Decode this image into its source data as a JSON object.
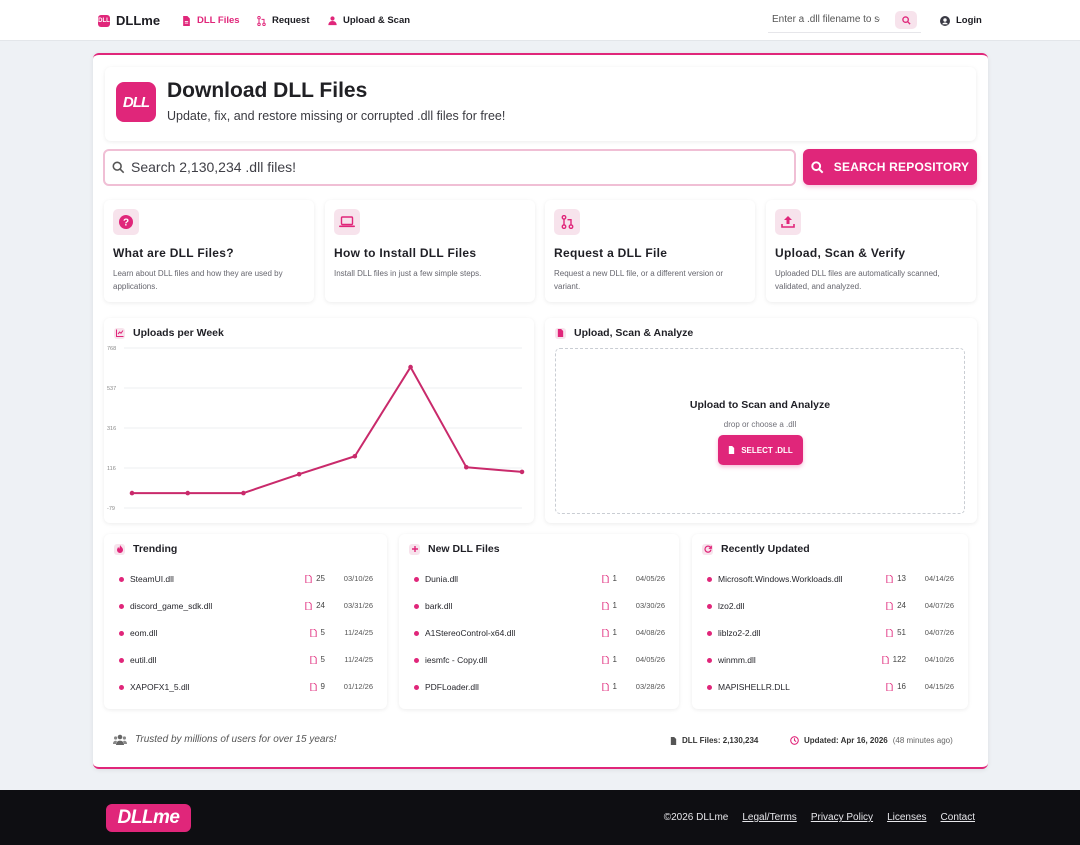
{
  "nav": {
    "brand": "DLLme",
    "brand_mark": "DLL",
    "links": [
      {
        "label": "DLL Files",
        "icon": "file-icon",
        "active": true
      },
      {
        "label": "Request",
        "icon": "request-icon"
      },
      {
        "label": "Upload & Scan",
        "icon": "upload-user-icon"
      }
    ],
    "search_placeholder": "Enter a .dll filename to search",
    "login_label": "Login"
  },
  "hero": {
    "logo_text": "DLL",
    "title": "Download DLL Files",
    "subtitle": "Update, fix, and restore missing or corrupted .dll files for free!"
  },
  "repo_search": {
    "placeholder": "Search 2,130,234 .dll files!",
    "button_label": "SEARCH REPOSITORY"
  },
  "features": [
    {
      "icon": "question-icon",
      "title": "What are DLL Files?",
      "desc": "Learn about DLL files and how they are used by applications."
    },
    {
      "icon": "laptop-icon",
      "title": "How to Install DLL Files",
      "desc": "Install DLL files in just a few simple steps."
    },
    {
      "icon": "pull-request-icon",
      "title": "Request a DLL File",
      "desc": "Request a new DLL file, or a different version or variant."
    },
    {
      "icon": "upload-icon",
      "title": "Upload, Scan & Verify",
      "desc": "Uploaded DLL files are automatically scanned, validated, and analyzed."
    }
  ],
  "chart_panel": {
    "title": "Uploads per Week"
  },
  "chart_data": {
    "type": "line",
    "x": [
      1,
      2,
      3,
      4,
      5,
      6,
      7,
      8
    ],
    "series": [
      {
        "values": [
          0,
          0,
          0,
          100,
          195,
          667,
          137,
          112
        ]
      }
    ],
    "ytick_labels": [
      "768",
      "537",
      "316",
      "116",
      "-79"
    ],
    "ylim": [
      -79,
      768
    ],
    "grid": true,
    "legend": "none",
    "color": "#c92a6b"
  },
  "upload_panel": {
    "title": "Upload, Scan & Analyze",
    "drop_title": "Upload to Scan and Analyze",
    "drop_sub": "drop or choose a .dll",
    "button_label": "SELECT .DLL"
  },
  "trending": {
    "title": "Trending",
    "items": [
      {
        "name": "SteamUI.dll",
        "count": "25",
        "date": "03/10/26"
      },
      {
        "name": "discord_game_sdk.dll",
        "count": "24",
        "date": "03/31/26"
      },
      {
        "name": "eom.dll",
        "count": "5",
        "date": "11/24/25"
      },
      {
        "name": "eutil.dll",
        "count": "5",
        "date": "11/24/25"
      },
      {
        "name": "XAPOFX1_5.dll",
        "count": "9",
        "date": "01/12/26"
      }
    ]
  },
  "new_files": {
    "title": "New DLL Files",
    "items": [
      {
        "name": "Dunia.dll",
        "count": "1",
        "date": "04/05/26"
      },
      {
        "name": "bark.dll",
        "count": "1",
        "date": "03/30/26"
      },
      {
        "name": "A1StereoControl-x64.dll",
        "count": "1",
        "date": "04/08/26"
      },
      {
        "name": "iesmfc - Copy.dll",
        "count": "1",
        "date": "04/05/26"
      },
      {
        "name": "PDFLoader.dll",
        "count": "1",
        "date": "03/28/26"
      }
    ]
  },
  "recent": {
    "title": "Recently Updated",
    "items": [
      {
        "name": "Microsoft.Windows.Workloads.dll",
        "count": "13",
        "date": "04/14/26"
      },
      {
        "name": "lzo2.dll",
        "count": "24",
        "date": "04/07/26"
      },
      {
        "name": "liblzo2-2.dll",
        "count": "51",
        "date": "04/07/26"
      },
      {
        "name": "winmm.dll",
        "count": "122",
        "date": "04/10/26"
      },
      {
        "name": "MAPISHELLR.DLL",
        "count": "16",
        "date": "04/15/26"
      }
    ]
  },
  "bottom": {
    "trust": "Trusted by millions of users for over 15 years!",
    "dll_count": "DLL Files: 2,130,234",
    "updated": "Updated: Apr 16, 2026",
    "updated_ago": "(48 minutes ago)"
  },
  "footer": {
    "logo": "DLLme",
    "copyright": "©2026 DLLme",
    "links": [
      "Legal/Terms",
      "Privacy Policy",
      "Licenses",
      "Contact"
    ]
  },
  "colors": {
    "accent": "#e0267a",
    "accent_light": "#f7e3ec",
    "footer_bg": "#0e0e12"
  }
}
